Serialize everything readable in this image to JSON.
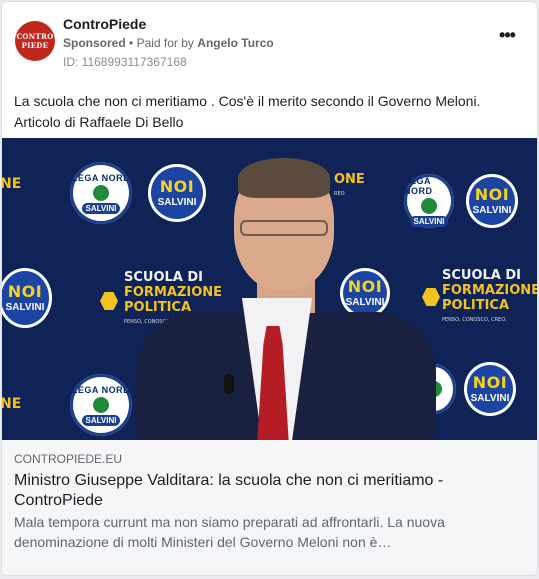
{
  "post": {
    "page_name": "ControPiede",
    "avatar": {
      "line1": "CONTRO",
      "line2": "PIEDE"
    },
    "sponsored": "Sponsored",
    "separator": "•",
    "paid_prefix": "Paid for by",
    "payer": "Angelo Turco",
    "ad_id": "ID: 1168993117367168",
    "more_icon": "•••",
    "text": "La scuola che non ci meritiamo . Cos'è il merito secondo il Governo Meloni. Articolo di Raffaele Di Bello"
  },
  "media": {
    "backdrop": {
      "lega_top": "LEGA NORD",
      "lega_bottom": "SALVINI",
      "noi": "NOI",
      "noi_salvini": "SALVINI",
      "scuola_line1": "SCUOLA DI",
      "scuola_line2": "FORMAZIONE",
      "scuola_line3": "POLITICA",
      "scuola_tagline_1": "PENSO, CONOSCO...",
      "scuola_tagline_2": "PENSO, CONOSCO, CREO.",
      "fragment_ne": "NE",
      "fragment_noi": "NOI",
      "fragment_salvini": "SALVINI",
      "fragment_one": "ONE",
      "fragment_reo": "REO."
    },
    "colors": {
      "bg": "#0f2356",
      "yellow": "#f4c31f",
      "tie": "#b51d24"
    }
  },
  "link": {
    "domain": "CONTROPIEDE.EU",
    "title": "Ministro Giuseppe Valditara: la scuola che non ci meritiamo - ControPiede",
    "description": "Mala tempora currunt ma non siamo preparati ad affrontarli. La nuova denominazione di molti Ministeri del Governo Meloni non è…"
  }
}
